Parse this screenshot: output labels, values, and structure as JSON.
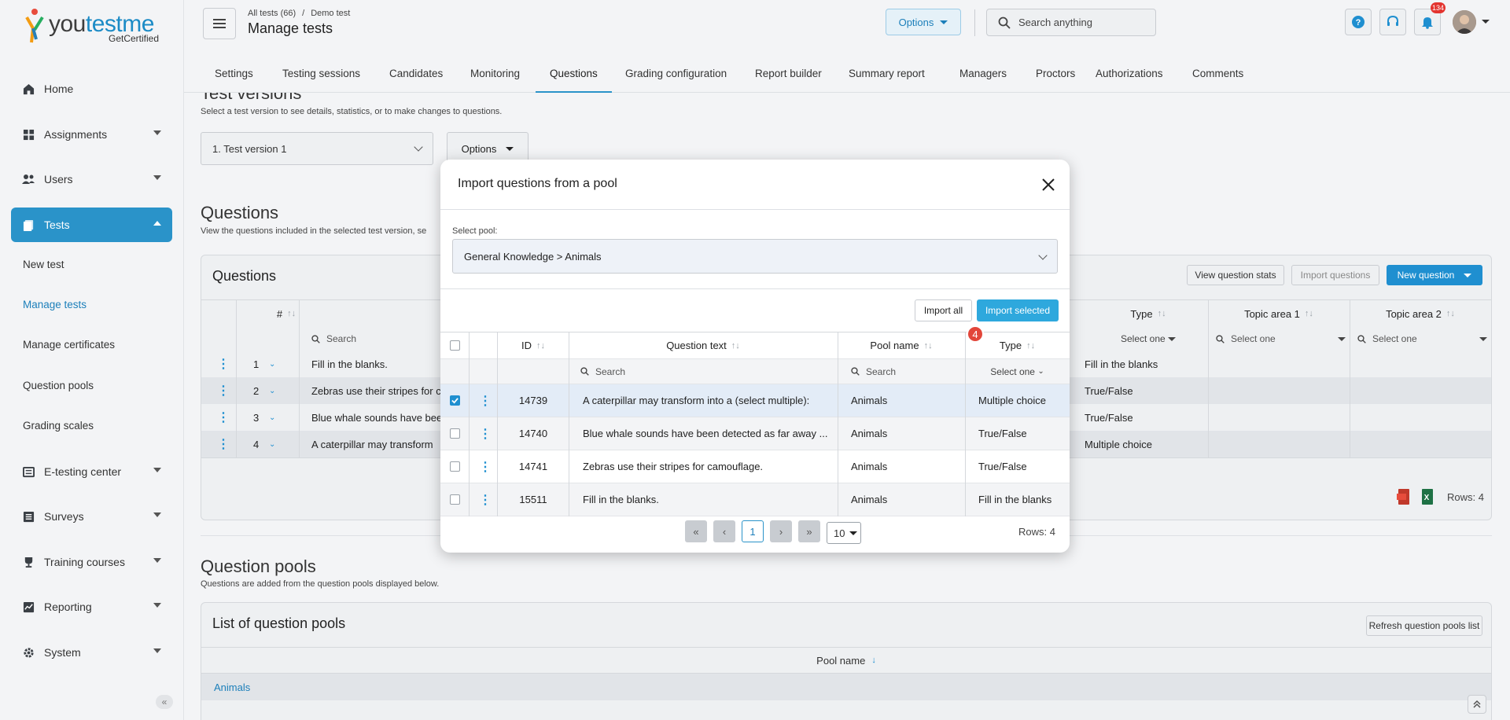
{
  "brand": {
    "name_part1": "you",
    "name_part2": "testme",
    "tagline": "GetCertified"
  },
  "sidebar": {
    "items": [
      {
        "label": "Home",
        "icon": "home-icon"
      },
      {
        "label": "Assignments",
        "icon": "assignments-icon"
      },
      {
        "label": "Users",
        "icon": "users-icon"
      },
      {
        "label": "Tests",
        "icon": "tests-icon"
      },
      {
        "label": "E-testing center",
        "icon": "building-icon"
      },
      {
        "label": "Surveys",
        "icon": "survey-icon"
      },
      {
        "label": "Training courses",
        "icon": "trophy-icon"
      },
      {
        "label": "Reporting",
        "icon": "chart-icon"
      },
      {
        "label": "System",
        "icon": "gear-icon"
      }
    ],
    "subitems": [
      "New test",
      "Manage tests",
      "Manage certificates",
      "Question pools",
      "Grading scales"
    ]
  },
  "header": {
    "breadcrumb": [
      "All tests (66)",
      "Demo test"
    ],
    "breadcrumb_sep": "/",
    "title": "Manage tests",
    "options_label": "Options",
    "search_placeholder": "Search anything",
    "notifications_count": "134"
  },
  "tabs": [
    "Settings",
    "Testing sessions",
    "Candidates",
    "Monitoring",
    "Questions",
    "Grading configuration",
    "Report builder",
    "Summary report",
    "Managers",
    "Proctors",
    "Authorizations",
    "Comments"
  ],
  "test_versions": {
    "title": "Test versions",
    "description": "Select a test version to see details, statistics, or to make changes to questions.",
    "selected": "1. Test version 1",
    "options_label": "Options"
  },
  "questions_section": {
    "title": "Questions",
    "description": "View the questions included in the selected test version, se",
    "panel_title": "Questions",
    "view_stats_label": "View question stats",
    "import_label": "Import questions",
    "new_question_label": "New question",
    "columns": {
      "num": "#",
      "type": "Type",
      "topic1": "Topic area 1",
      "topic2": "Topic area 2"
    },
    "search_placeholder": "Search",
    "select_one": "Select one",
    "rows": [
      {
        "num": "1",
        "text": "Fill in the blanks.",
        "type": "Fill in the blanks"
      },
      {
        "num": "2",
        "text": "Zebras use their stripes for c",
        "type": "True/False"
      },
      {
        "num": "3",
        "text": "Blue whale sounds have bee",
        "type": "True/False"
      },
      {
        "num": "4",
        "text": "A caterpillar may transform",
        "type": "Multiple choice"
      }
    ],
    "rows_count": "Rows: 4"
  },
  "pools_section": {
    "title": "Question pools",
    "description": "Questions are added from the question pools displayed below.",
    "panel_title": "List of question pools",
    "refresh_label": "Refresh question pools list",
    "column": "Pool name",
    "first_pool": "Animals"
  },
  "modal": {
    "title": "Import questions from a pool",
    "select_label": "Select pool:",
    "selected_pool": "General Knowledge > Animals",
    "import_all": "Import all",
    "import_selected": "Import selected",
    "badge": "4",
    "columns": {
      "id": "ID",
      "text": "Question text",
      "pool": "Pool name",
      "type": "Type"
    },
    "search_placeholder": "Search",
    "select_one": "Select one",
    "rows": [
      {
        "id": "14739",
        "text": "A caterpillar may transform into a (select multiple):",
        "pool": "Animals",
        "type": "Multiple choice",
        "checked": true
      },
      {
        "id": "14740",
        "text": "Blue whale sounds have been detected as far away ...",
        "pool": "Animals",
        "type": "True/False",
        "checked": false
      },
      {
        "id": "14741",
        "text": "Zebras use their stripes for camouflage.",
        "pool": "Animals",
        "type": "True/False",
        "checked": false
      },
      {
        "id": "15511",
        "text": "Fill in the blanks.",
        "pool": "Animals",
        "type": "Fill in the blanks",
        "checked": false
      }
    ],
    "current_page": "1",
    "page_size": "10",
    "rows_count": "Rows: 4"
  },
  "colors": {
    "accent": "#2a93c9",
    "primary_button": "#1f8fd0",
    "badge": "#e2463a"
  }
}
